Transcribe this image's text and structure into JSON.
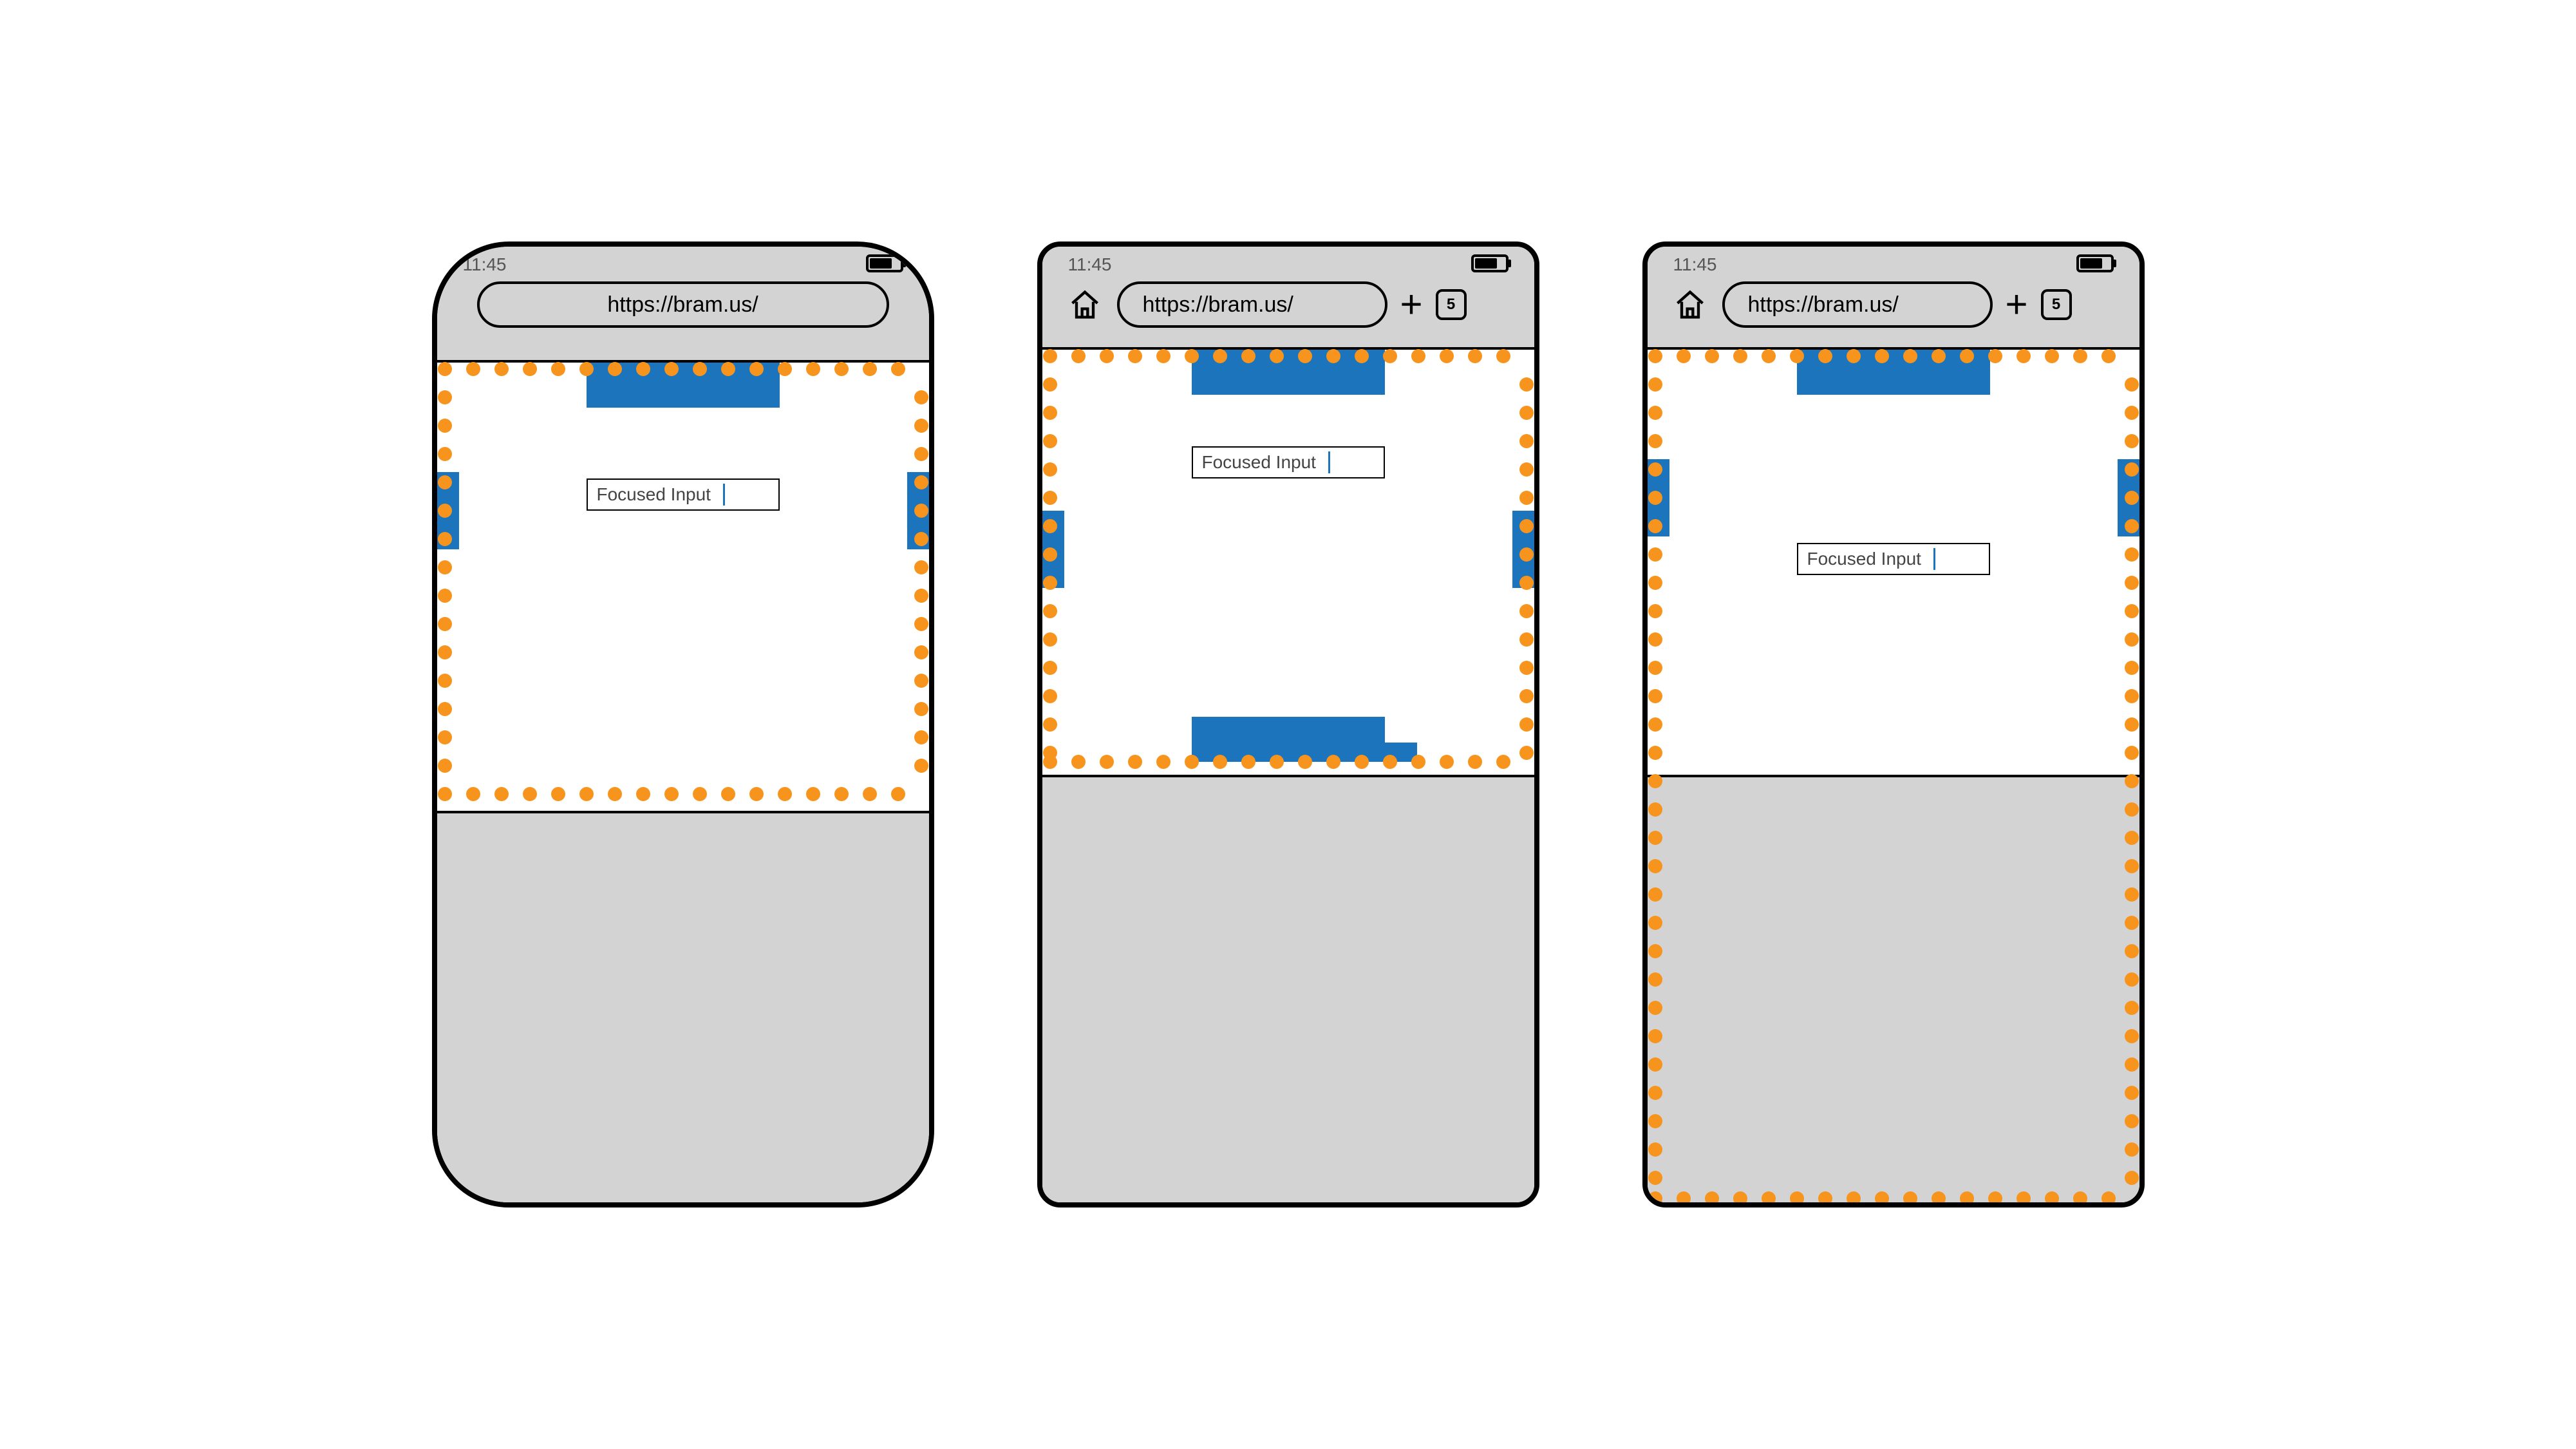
{
  "status": {
    "time": "11:45",
    "battery_pct": 75
  },
  "browser": {
    "url": "https://bram.us/",
    "tab_count": "5"
  },
  "input": {
    "value": "Focused Input"
  },
  "colors": {
    "accent_blue": "#1c75bc",
    "dotted_orange": "#f7941d",
    "chrome_gray": "#d3d3d3"
  },
  "diagram": {
    "description": "Three mobile browser mockups showing how fixed-position page elements and the visual viewport (orange dotted outline) behave when the on-screen keyboard is shown.",
    "variants": [
      {
        "id": "A",
        "frame": "rounded-big notch",
        "keyboard_resizes_viewport": false,
        "orange_outline_covers_keyboard": false
      },
      {
        "id": "B",
        "frame": "rounded-small",
        "keyboard_resizes_viewport": true,
        "orange_outline_covers_keyboard": false
      },
      {
        "id": "C",
        "frame": "rounded-small",
        "keyboard_resizes_viewport": false,
        "orange_outline_covers_keyboard": true
      }
    ]
  }
}
